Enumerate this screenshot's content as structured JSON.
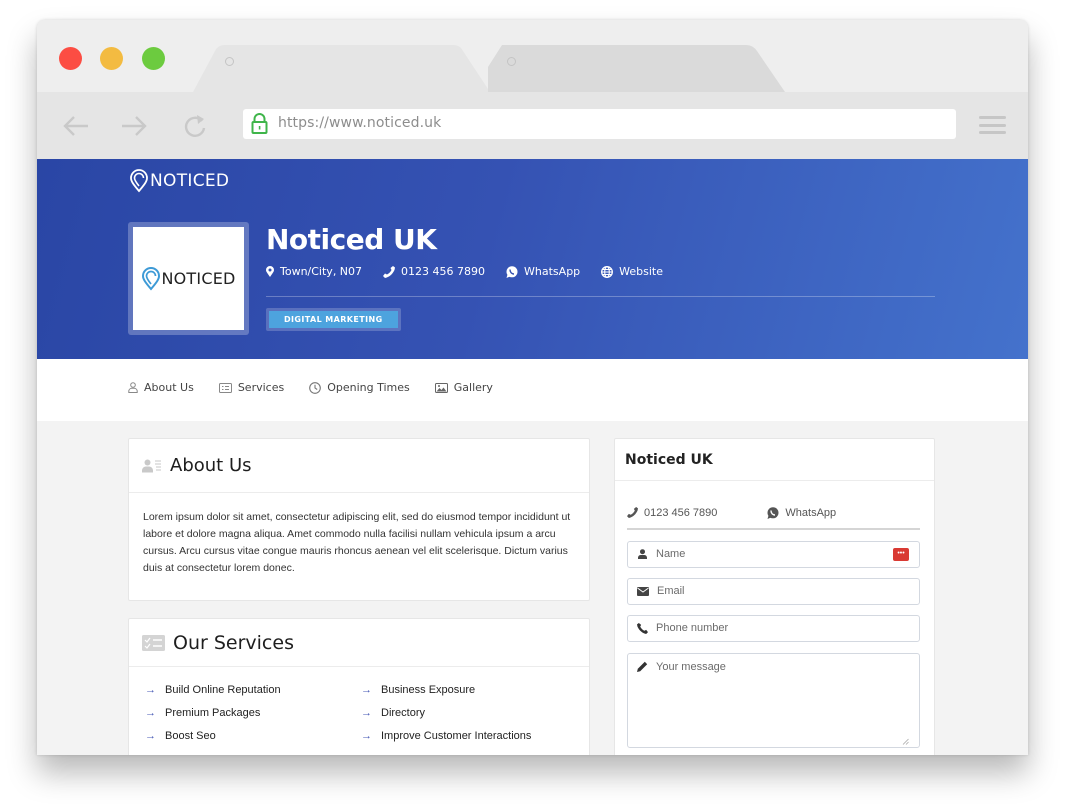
{
  "browser": {
    "url": "https://www.noticed.uk",
    "tabs": [
      {
        "label": ""
      },
      {
        "label": ""
      }
    ]
  },
  "header": {
    "brand": "NOTICED",
    "logo_text": "NOTICED",
    "business_name": "Noticed UK",
    "location": "Town/City, N07",
    "phone": "0123 456 7890",
    "whatsapp": "WhatsApp",
    "website": "Website",
    "category": "DIGITAL MARKETING"
  },
  "subnav": {
    "items": [
      {
        "label": "About Us",
        "icon": "user-icon"
      },
      {
        "label": "Services",
        "icon": "list-icon"
      },
      {
        "label": "Opening Times",
        "icon": "clock-icon"
      },
      {
        "label": "Gallery",
        "icon": "image-icon"
      }
    ]
  },
  "about": {
    "title": "About Us",
    "body": "Lorem ipsum dolor sit amet, consectetur adipiscing elit, sed do eiusmod tempor incididunt ut labore et dolore magna aliqua. Amet commodo nulla facilisi nullam vehicula ipsum a arcu cursus. Arcu cursus vitae congue mauris rhoncus aenean vel elit scelerisque. Dictum varius duis at consectetur lorem donec."
  },
  "services": {
    "title": "Our Services",
    "items": [
      "Build Online Reputation",
      "Business Exposure",
      "Premium Packages",
      "Directory",
      "Boost Seo",
      "Improve Customer Interactions"
    ]
  },
  "contact": {
    "title": "Noticed UK",
    "phone": "0123 456 7890",
    "whatsapp": "WhatsApp",
    "form": {
      "name_placeholder": "Name",
      "email_placeholder": "Email",
      "phone_placeholder": "Phone number",
      "message_placeholder": "Your message",
      "name_badge": "•••"
    }
  },
  "colors": {
    "hero_start": "#2a46a5",
    "hero_end": "#4472cc",
    "category_badge": "#4da3de",
    "service_arrow": "#4356b4",
    "lock": "#3fb54a"
  }
}
